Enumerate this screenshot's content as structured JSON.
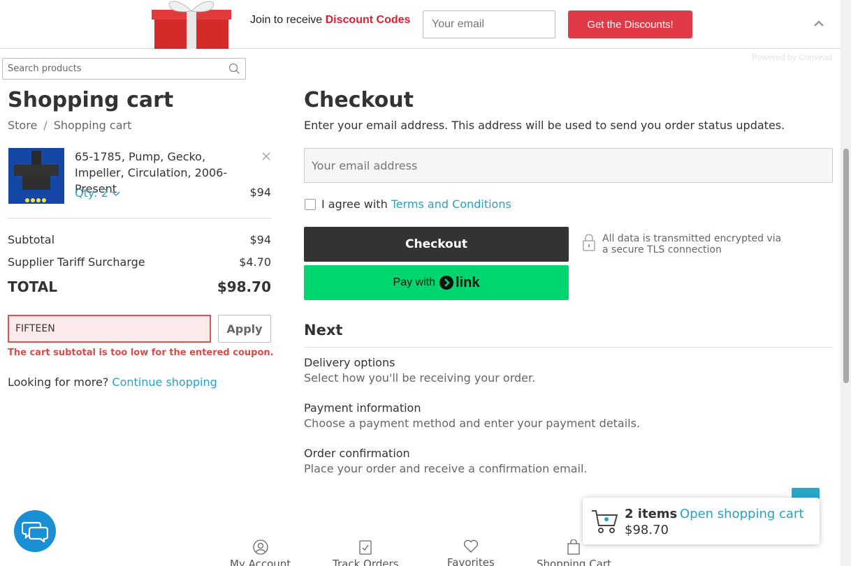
{
  "promo": {
    "text": "Join to receive",
    "highlight": "Discount Codes",
    "email_placeholder": "Your email",
    "button_label": "Get the Discounts!",
    "powered_by": "Powered by Convead"
  },
  "search": {
    "placeholder": "Search products"
  },
  "cart": {
    "title": "Shopping cart",
    "breadcrumb": [
      "Store",
      "Shopping cart"
    ],
    "item": {
      "name": "65-1785, Pump, Gecko, Impeller, Circulation, 2006-Present",
      "qty_label": "Qty: 2",
      "price": "$94"
    },
    "subtotal_label": "Subtotal",
    "subtotal_value": "$94",
    "tariff_label": "Supplier Tariff Surcharge",
    "tariff_value": "$4.70",
    "total_label": "TOTAL",
    "total_value": "$98.70",
    "coupon_value": "FIFTEEN",
    "apply_label": "Apply",
    "coupon_error": "The cart subtotal is too low for the entered coupon.",
    "more_text": "Looking for more?",
    "continue_label": "Continue shopping"
  },
  "checkout": {
    "title": "Checkout",
    "description": "Enter your email address. This address will be used to send you order status updates.",
    "email_placeholder": "Your email address",
    "agree_text": "I agree with",
    "terms_label": "Terms and Conditions",
    "checkout_label": "Checkout",
    "pay_with": "Pay with",
    "link_label": "link",
    "secure_text": "All data is transmitted encrypted via a secure TLS connection",
    "next_title": "Next",
    "steps": [
      {
        "title": "Delivery options",
        "desc": "Select how you'll be receiving your order."
      },
      {
        "title": "Payment information",
        "desc": "Choose a payment method and enter your payment details."
      },
      {
        "title": "Order confirmation",
        "desc": "Place your order and receive a confirmation email."
      }
    ]
  },
  "mini_cart": {
    "count": "2 items",
    "open_label": "Open shopping cart",
    "amount": "$98.70"
  },
  "bottom_nav": [
    "My Account",
    "Track Orders",
    "Favorites",
    "Shopping Cart"
  ],
  "colors": {
    "accent": "#2aa0c4",
    "promo_red": "#e13a47",
    "link_green": "#00d66f",
    "error": "#dc4a4a"
  }
}
